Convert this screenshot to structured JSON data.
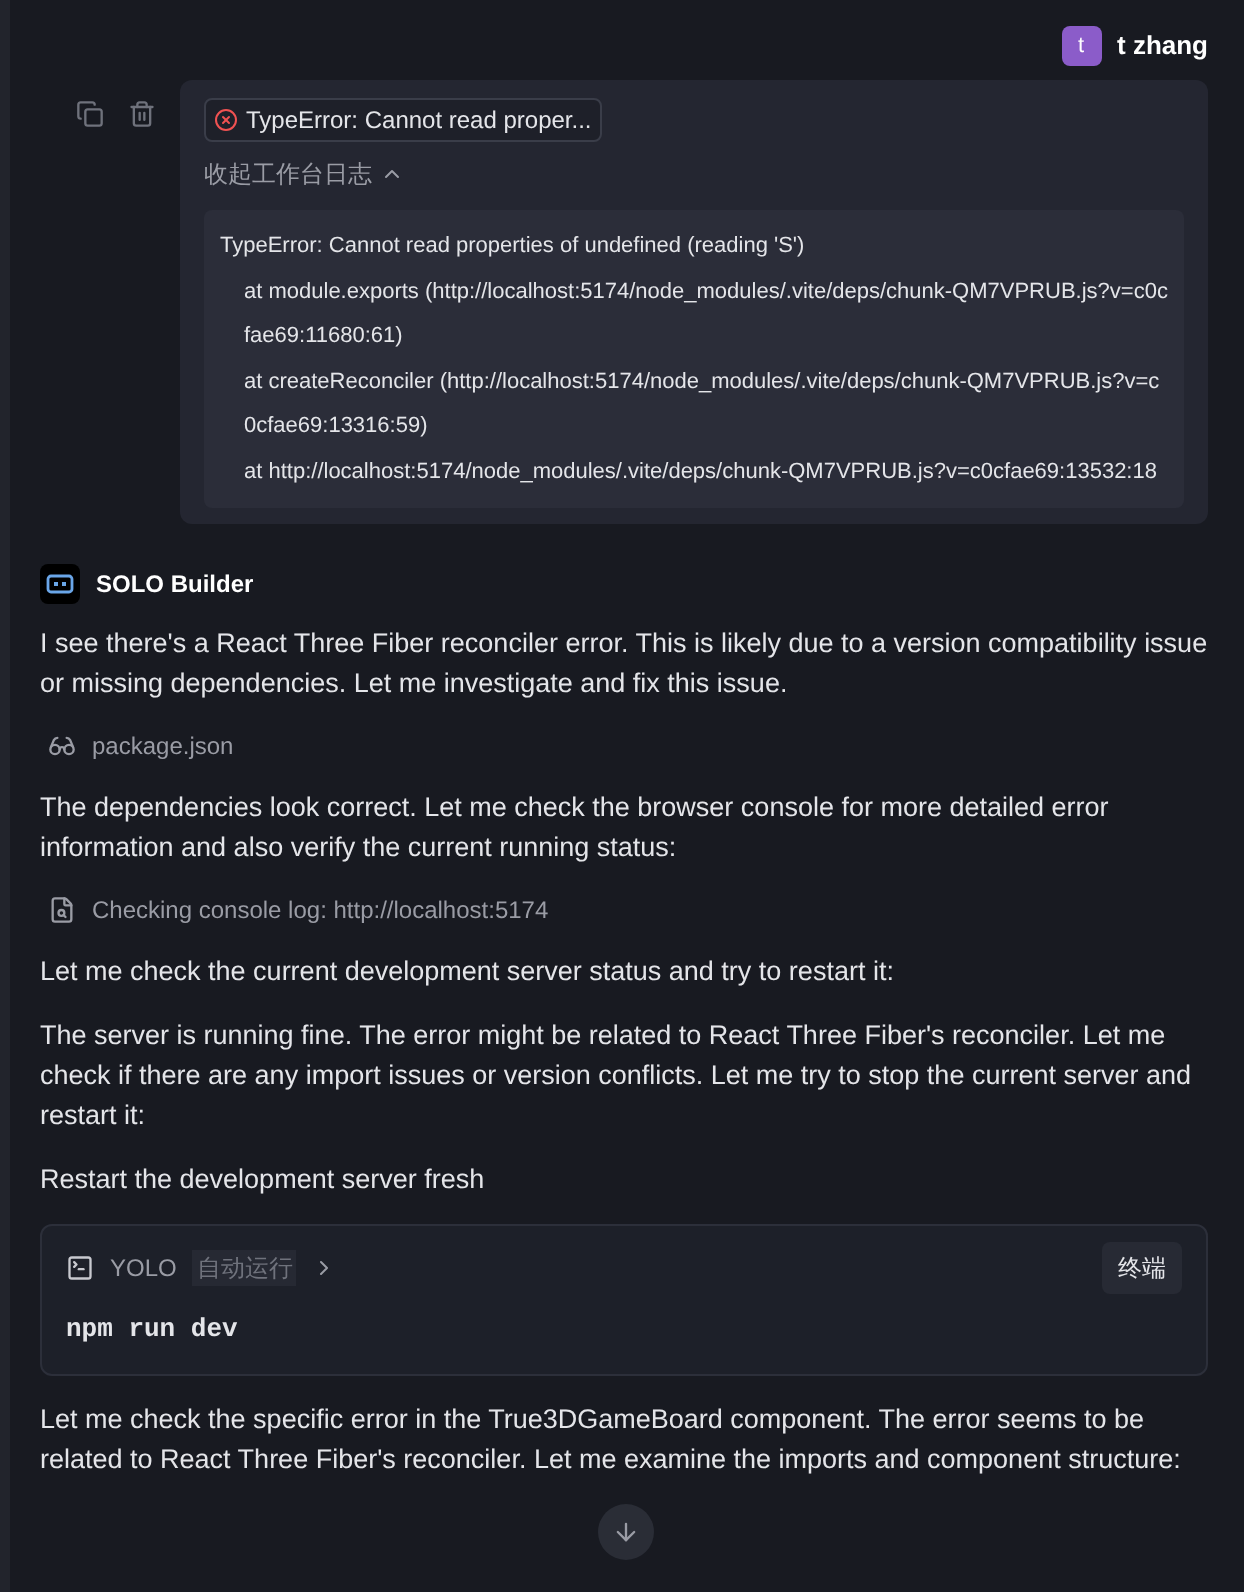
{
  "user": {
    "initial": "t",
    "name": "t zhang"
  },
  "error_card": {
    "badge": "TypeError: Cannot read proper...",
    "toggle": "收起工作台日志",
    "expanded": true,
    "log": [
      "TypeError: Cannot read properties of undefined (reading 'S')",
      "at module.exports (http://localhost:5174/node_modules/.vite/deps/chunk-QM7VPRUB.js?v=c0cfae69:11680:61)",
      "at createReconciler (http://localhost:5174/node_modules/.vite/deps/chunk-QM7VPRUB.js?v=c0cfae69:13316:59)",
      "at http://localhost:5174/node_modules/.vite/deps/chunk-QM7VPRUB.js?v=c0cfae69:13532:18"
    ]
  },
  "assistant": {
    "name": "SOLO Builder"
  },
  "messages": [
    {
      "kind": "text",
      "text": "I see there's a React Three Fiber reconciler error. This is likely due to a version compatibility issue or missing dependencies. Let me investigate and fix this issue."
    },
    {
      "kind": "view",
      "text": "package.json"
    },
    {
      "kind": "text",
      "text": "The dependencies look correct. Let me check the browser console for more detailed error information and also verify the current running status:"
    },
    {
      "kind": "console",
      "text": "Checking console log: http://localhost:5174"
    },
    {
      "kind": "text",
      "text": "Let me check the current development server status and try to restart it:"
    },
    {
      "kind": "text",
      "text": "The server is running fine. The error might be related to React Three Fiber's reconciler. Let me check if there are any import issues or version conflicts. Let me try to stop the current server and restart it:"
    },
    {
      "kind": "text",
      "text": "Restart the development server fresh"
    },
    {
      "kind": "command",
      "mode": "YOLO",
      "tag": "自动运行",
      "button": "终端",
      "command": "npm run dev"
    },
    {
      "kind": "text",
      "text": "Let me check the specific error in the True3DGameBoard component. The error seems to be related to React Three Fiber's reconciler. Let me examine the imports and component structure:"
    }
  ]
}
